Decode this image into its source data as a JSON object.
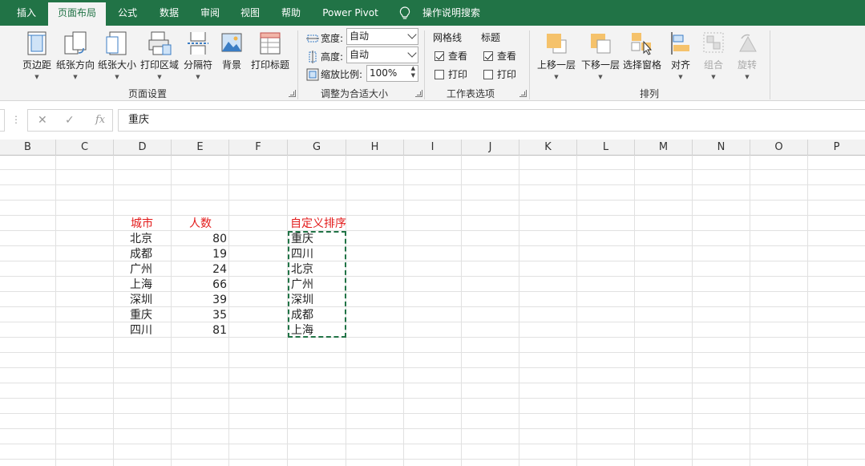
{
  "tabs": [
    "插入",
    "页面布局",
    "公式",
    "数据",
    "审阅",
    "视图",
    "帮助",
    "Power Pivot",
    "操作说明搜索"
  ],
  "active_tab": "页面布局",
  "ribbon": {
    "page_setup": {
      "buttons": [
        "页边距",
        "纸张方向",
        "纸张大小",
        "打印区域",
        "分隔符",
        "背景",
        "打印标题"
      ],
      "label": "页面设置"
    },
    "scale_to_fit": {
      "width_label": "宽度:",
      "width_value": "自动",
      "height_label": "高度:",
      "height_value": "自动",
      "scale_label": "缩放比例:",
      "scale_value": "100%",
      "label": "调整为合适大小"
    },
    "sheet_options": {
      "gridlines_title": "网格线",
      "headings_title": "标题",
      "view_label": "查看",
      "print_label": "打印",
      "gridlines_view": true,
      "gridlines_print": false,
      "headings_view": true,
      "headings_print": false,
      "label": "工作表选项"
    },
    "arrange": {
      "buttons": [
        "上移一层",
        "下移一层",
        "选择窗格",
        "对齐",
        "组合",
        "旋转"
      ],
      "label": "排列"
    }
  },
  "formula_bar": {
    "cancel_icon": "✕",
    "enter_icon": "✓",
    "fx_label": "fx",
    "content": "重庆"
  },
  "columns": [
    "B",
    "C",
    "D",
    "E",
    "F",
    "G",
    "H",
    "I",
    "J",
    "K",
    "L",
    "M",
    "N",
    "O",
    "P"
  ],
  "table": {
    "header_city": "城市",
    "header_count": "人数",
    "rows": [
      {
        "city": "北京",
        "count": "80"
      },
      {
        "city": "成都",
        "count": "19"
      },
      {
        "city": "广州",
        "count": "24"
      },
      {
        "city": "上海",
        "count": "66"
      },
      {
        "city": "深圳",
        "count": "39"
      },
      {
        "city": "重庆",
        "count": "35"
      },
      {
        "city": "四川",
        "count": "81"
      }
    ]
  },
  "custom_sort": {
    "header": "自定义排序",
    "items": [
      "重庆",
      "四川",
      "北京",
      "广州",
      "深圳",
      "成都",
      "上海"
    ]
  },
  "colors": {
    "excel_green": "#217346",
    "header_red": "#e31c1c"
  }
}
